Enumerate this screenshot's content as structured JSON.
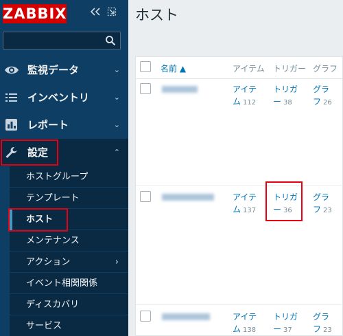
{
  "sidebar": {
    "logo": "ZABBIX",
    "collapse_icon": "double-chevron-left-icon",
    "expand_icon": "expand-icon",
    "search": {
      "value": "",
      "placeholder": ""
    },
    "menus": [
      {
        "label": "監視データ",
        "icon": "eye-icon",
        "chevron": "⌄"
      },
      {
        "label": "インベントリ",
        "icon": "list-icon",
        "chevron": "⌄"
      },
      {
        "label": "レポート",
        "icon": "bar-chart-icon",
        "chevron": "⌄"
      },
      {
        "label": "設定",
        "icon": "wrench-icon",
        "chevron": "⌃"
      }
    ],
    "submenu": [
      {
        "label": "ホストグループ"
      },
      {
        "label": "テンプレート"
      },
      {
        "label": "ホスト"
      },
      {
        "label": "メンテナンス"
      },
      {
        "label": "アクション",
        "chevron": "›"
      },
      {
        "label": "イベント相関関係"
      },
      {
        "label": "ディスカバリ"
      },
      {
        "label": "サービス"
      }
    ]
  },
  "main": {
    "title": "ホスト",
    "table": {
      "columns": {
        "name": "名前 ▲",
        "items": "アイテム",
        "triggers": "トリガー",
        "graphs": "グラフ"
      },
      "rows": [
        {
          "items_l1": "アイテ",
          "items_l2": "ム",
          "items_count": "112",
          "triggers_l1": "トリガ",
          "triggers_l2": "ー",
          "triggers_count": "38",
          "graphs_l1": "グラ",
          "graphs_l2": "フ",
          "graphs_count": "26"
        },
        {
          "items_l1": "アイテ",
          "items_l2": "ム",
          "items_count": "137",
          "triggers_l1": "トリガ",
          "triggers_l2": "ー",
          "triggers_count": "36",
          "graphs_l1": "グラ",
          "graphs_l2": "フ",
          "graphs_count": "23"
        },
        {
          "items_l1": "アイテ",
          "items_l2": "ム",
          "items_count": "138",
          "triggers_l1": "トリガ",
          "triggers_l2": "ー",
          "triggers_count": "37",
          "graphs_l1": "グラ",
          "graphs_l2": "フ",
          "graphs_count": "23"
        }
      ]
    }
  },
  "colors": {
    "sidebar": "#0e3e63",
    "submenu": "#0a2a44",
    "logo": "#d40000",
    "link": "#0275b8",
    "highlight": "#e60012"
  }
}
